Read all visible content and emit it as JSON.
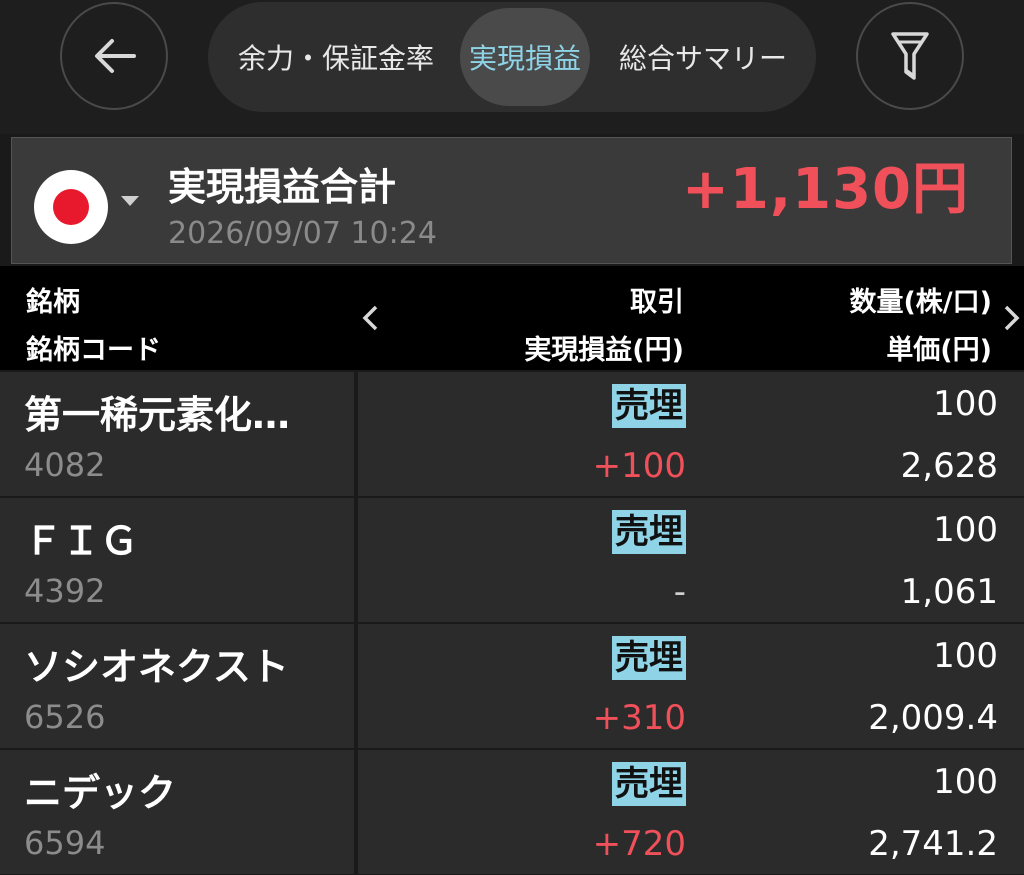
{
  "nav": {
    "tabs": [
      {
        "label": "余力・保証金率"
      },
      {
        "label": "実現損益",
        "active": true
      },
      {
        "label": "総合サマリー"
      }
    ],
    "back_icon": "arrow-left-icon",
    "filter_icon": "filter-icon"
  },
  "summary": {
    "title": "実現損益合計",
    "datetime": "2026/09/07 10:24",
    "total": "+1,130円",
    "flag": "japan-flag-icon"
  },
  "table": {
    "headers": {
      "name": "銘柄",
      "code": "銘柄コード",
      "trade": "取引",
      "realized_pl": "実現損益(円)",
      "quantity": "数量(株/口)",
      "unit_price": "単価(円)"
    },
    "rows": [
      {
        "name": "第一稀元素化…",
        "code": "4082",
        "trade": "売埋",
        "pl": "+100",
        "qty": "100",
        "price": "2,628"
      },
      {
        "name": "ＦＩＧ",
        "code": "4392",
        "trade": "売埋",
        "pl": "-",
        "qty": "100",
        "price": "1,061"
      },
      {
        "name": "ソシオネクスト",
        "code": "6526",
        "trade": "売埋",
        "pl": "+310",
        "qty": "100",
        "price": "2,009.4"
      },
      {
        "name": "ニデック",
        "code": "6594",
        "trade": "売埋",
        "pl": "+720",
        "qty": "100",
        "price": "2,741.2"
      }
    ]
  },
  "colors": {
    "profit": "#f0505a",
    "accent": "#8fd3e6",
    "background": "#1a1a1a"
  }
}
